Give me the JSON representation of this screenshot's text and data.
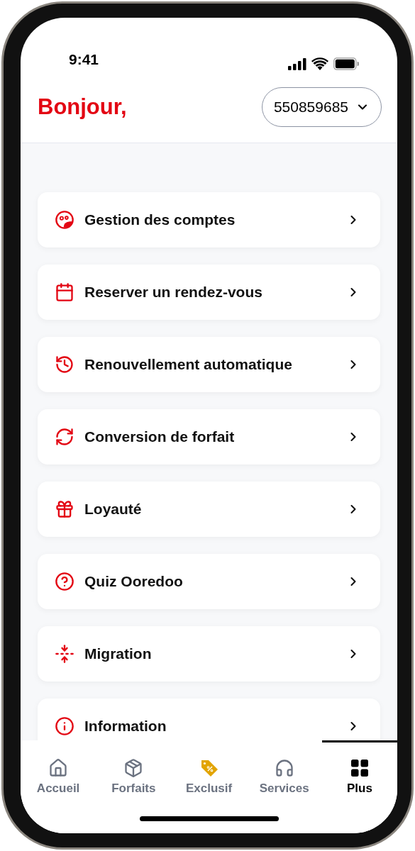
{
  "status_bar": {
    "time": "9:41"
  },
  "header": {
    "greeting": "Bonjour,",
    "account": "550859685"
  },
  "menu": [
    {
      "kind": "accounts",
      "label": "Gestion des comptes"
    },
    {
      "kind": "calendar",
      "label": "Reserver un rendez-vous"
    },
    {
      "kind": "history",
      "label": "Renouvellement automatique"
    },
    {
      "kind": "convert",
      "label": "Conversion de forfait"
    },
    {
      "kind": "gift",
      "label": "Loyauté"
    },
    {
      "kind": "quiz",
      "label": "Quiz Ooredoo"
    },
    {
      "kind": "migration",
      "label": "Migration"
    },
    {
      "kind": "info",
      "label": "Information"
    }
  ],
  "tabs": [
    {
      "kind": "home",
      "label": "Accueil",
      "selected": false
    },
    {
      "kind": "package",
      "label": "Forfaits",
      "selected": false
    },
    {
      "kind": "tag",
      "label": "Exclusif",
      "selected": false
    },
    {
      "kind": "headphones",
      "label": "Services",
      "selected": false
    },
    {
      "kind": "grid",
      "label": "Plus",
      "selected": true
    }
  ]
}
